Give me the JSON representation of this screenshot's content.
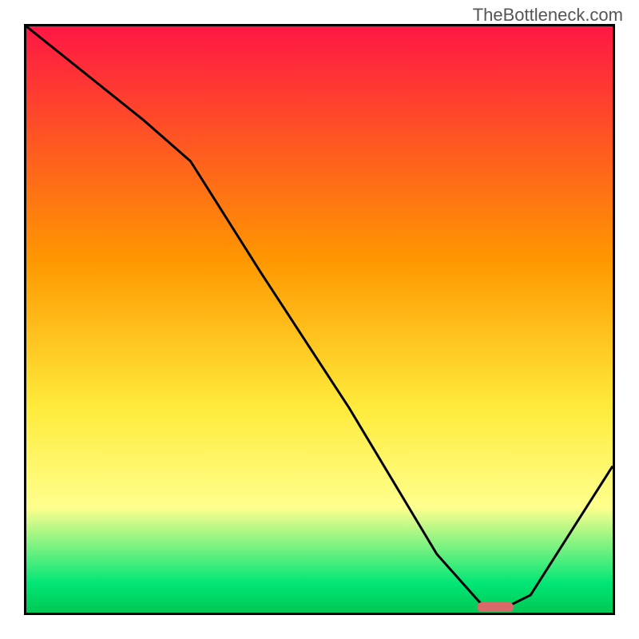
{
  "watermark": "TheBottleneck.com",
  "chart_data": {
    "type": "line",
    "title": "",
    "xlabel": "",
    "ylabel": "",
    "xlim": [
      0,
      100
    ],
    "ylim": [
      0,
      100
    ],
    "gradient_stops": [
      {
        "offset": 0,
        "color": "#ff1744"
      },
      {
        "offset": 40,
        "color": "#ff9800"
      },
      {
        "offset": 65,
        "color": "#ffeb3b"
      },
      {
        "offset": 82,
        "color": "#ffff8d"
      },
      {
        "offset": 95,
        "color": "#00e676"
      },
      {
        "offset": 100,
        "color": "#00c853"
      }
    ],
    "series": [
      {
        "name": "bottleneck-curve",
        "x": [
          0,
          10,
          20,
          28,
          40,
          55,
          70,
          78,
          82,
          86,
          100
        ],
        "y": [
          100,
          92,
          84,
          77,
          58,
          35,
          10,
          1,
          1,
          3,
          25
        ]
      }
    ],
    "marker": {
      "x": 80,
      "y": 1,
      "color": "#d96a6a"
    }
  }
}
